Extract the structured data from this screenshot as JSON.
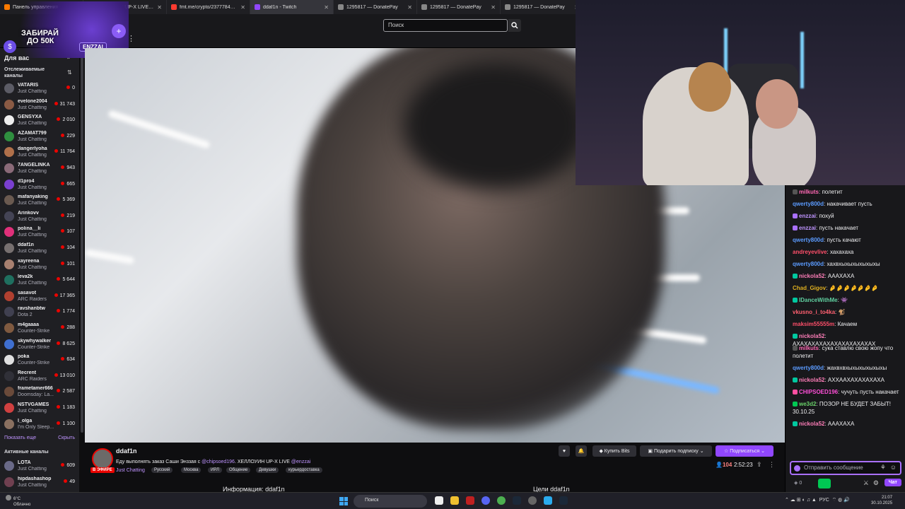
{
  "browser": {
    "tabs": [
      {
        "label": "Панель управления - Donatio",
        "color": "#ff7a00",
        "active": false
      },
      {
        "label": "ХЕЛЛОУИН UP-X LIVE - Twitch",
        "color": "#9147ff",
        "active": false
      },
      {
        "label": "fmt.me/crypto/237778422/cf39",
        "color": "#ff3b30",
        "active": false
      },
      {
        "label": "ddaf1n - Twitch",
        "color": "#9147ff",
        "active": true
      },
      {
        "label": "1295817 — DonatePay",
        "color": "#888888",
        "active": false
      },
      {
        "label": "1295817 — DonatePay",
        "color": "#888888",
        "active": false
      },
      {
        "label": "1295817 — DonatePay",
        "color": "#888888",
        "active": false
      }
    ]
  },
  "promo": {
    "line1": "ЗАБИРАЙ",
    "line2": "ДО 50К",
    "code_label": "ENZZAI",
    "coin": "$",
    "plus": "+"
  },
  "header": {
    "search_placeholder": "Поиск"
  },
  "sidebar": {
    "title": "Для вас",
    "followed_label": "Отслеживаемые каналы",
    "channels": [
      {
        "name": "VATARIS",
        "game": "Just Chatting",
        "viewers": "0",
        "color": "#5c5c66"
      },
      {
        "name": "evelone2004",
        "game": "Just Chatting",
        "viewers": "31 743",
        "color": "#8a5a44"
      },
      {
        "name": "GENSYXA",
        "game": "Just Chatting",
        "viewers": "2 010",
        "color": "#eeeeee"
      },
      {
        "name": "AZAMAT799",
        "game": "Just Chatting",
        "viewers": "229",
        "color": "#2f8f3f"
      },
      {
        "name": "dangerlyoha",
        "game": "Just Chatting",
        "viewers": "11 764",
        "color": "#b0704a"
      },
      {
        "name": "7ANGELINKA",
        "game": "Just Chatting",
        "viewers": "943",
        "color": "#8a6a78"
      },
      {
        "name": "d1pro4",
        "game": "Just Chatting",
        "viewers": "665",
        "color": "#7a3fd0"
      },
      {
        "name": "mafanyaking",
        "game": "Just Chatting",
        "viewers": "5 369",
        "color": "#6a5a50"
      },
      {
        "name": "Arinkovv",
        "game": "Just Chatting",
        "viewers": "219",
        "color": "#444455"
      },
      {
        "name": "polina__li",
        "game": "Just Chatting",
        "viewers": "107",
        "color": "#e0307a"
      },
      {
        "name": "ddaf1n",
        "game": "Just Chatting",
        "viewers": "104",
        "color": "#777070"
      },
      {
        "name": "xayreena",
        "game": "Just Chatting",
        "viewers": "101",
        "color": "#a88070"
      },
      {
        "name": "leva2k",
        "game": "Just Chatting",
        "viewers": "5 644",
        "color": "#1f6f5f"
      },
      {
        "name": "sasavot",
        "game": "ARC Raiders",
        "viewers": "17 365",
        "color": "#b04030"
      },
      {
        "name": "ravshanbtw",
        "game": "Dota 2",
        "viewers": "1 774",
        "color": "#404050"
      },
      {
        "name": "m4gaaaa",
        "game": "Counter-Strike",
        "viewers": "288",
        "color": "#805a40"
      },
      {
        "name": "skywhywalker",
        "game": "Counter-Strike",
        "viewers": "8 625",
        "color": "#3f6fd0"
      },
      {
        "name": "poka",
        "game": "Counter-Strike",
        "viewers": "634",
        "color": "#e0e0e0"
      },
      {
        "name": "Recrent",
        "game": "ARC Raiders",
        "viewers": "13 010",
        "color": "#303038"
      },
      {
        "name": "frametamer666",
        "game": "Doomsday: La...",
        "viewers": "2 587",
        "color": "#6a4a3a"
      },
      {
        "name": "NSTVGAMES",
        "game": "Just Chatting",
        "viewers": "1 183",
        "color": "#d04040"
      },
      {
        "name": "l_olga",
        "game": "I'm Only Sleep...",
        "viewers": "1 100",
        "color": "#8a7060"
      }
    ],
    "show_more": "Показать еще",
    "hide": "Скрыть",
    "active_label": "Активные каналы",
    "active_channels": [
      {
        "name": "LOTA",
        "game": "Just Chatting",
        "viewers": "609",
        "color": "#6a6a88"
      },
      {
        "name": "hipdashashop",
        "game": "Just Chatting",
        "viewers": "49",
        "color": "#704050"
      }
    ]
  },
  "stream": {
    "streamer": "ddaf1n",
    "live_badge": "В ЭФИРЕ",
    "title": "Еду выполнять заказ Саши Энззая с ",
    "mention1": "@chipsoed196",
    "title2": ". ХЕЛЛОУИН UP-X LIVE ",
    "mention2": "@enzzai",
    "category": "Just Chatting",
    "tags": [
      "Русский",
      "Москва",
      "ИРЛ",
      "Общение",
      "Девушки",
      "курьердоставка"
    ],
    "buy_bits": "Купить Bits",
    "gift_sub": "Подарить подписку",
    "subscribe": "Подписаться",
    "viewers": "104",
    "uptime": "2:52:23",
    "about": "Информация: ddaf1n",
    "goals": "Цели ddaf1n"
  },
  "chat": {
    "messages": [
      {
        "user": "milkuts",
        "color": "#ff69b4",
        "text": "полетит",
        "badge": "#555555"
      },
      {
        "user": "qwerty800d",
        "color": "#5b9bff",
        "text": "накачивает пусть",
        "badge": ""
      },
      {
        "user": "enzzai",
        "color": "#bf94ff",
        "text": "похуй",
        "badge": "#a970ff"
      },
      {
        "user": "enzzai",
        "color": "#bf94ff",
        "text": "пусть накачает",
        "badge": "#a970ff"
      },
      {
        "user": "qwerty800d",
        "color": "#5b9bff",
        "text": "пусть качают",
        "badge": ""
      },
      {
        "user": "andreyevlive",
        "color": "#ff4f6a",
        "text": "хахахаха",
        "badge": ""
      },
      {
        "user": "qwerty800d",
        "color": "#5b9bff",
        "text": "хахвхыхыхыхыхыхы",
        "badge": ""
      },
      {
        "user": "nickola52",
        "color": "#ff7eb9",
        "text": "АААХАХА",
        "badge": "#00c8a0"
      },
      {
        "user": "Chad_Gigov",
        "color": "#e0b020",
        "text": "🤌🤌🤌🤌🤌🤌🤌",
        "badge": ""
      },
      {
        "user": "IDanceWithMe",
        "color": "#60d0a0",
        "text": "👾",
        "badge": "#00c8a0"
      },
      {
        "user": "vkusno_i_to4ka",
        "color": "#ff6070",
        "text": "🐒",
        "badge": ""
      },
      {
        "user": "maksim55555m",
        "color": "#ff4f6a",
        "text": "Качаем",
        "badge": ""
      },
      {
        "user": "nickola52",
        "color": "#ff7eb9",
        "text": "АХАХАХАХАХАХАХАХАХАХАХ",
        "badge": "#00c8a0"
      },
      {
        "user": "milkuts",
        "color": "#ff69b4",
        "text": "сука ставлю свою жопу что полетит",
        "badge": "#555555"
      },
      {
        "user": "qwerty800d",
        "color": "#5b9bff",
        "text": "жахвхвхыхыхыхыхыхы",
        "badge": ""
      },
      {
        "user": "nickola52",
        "color": "#ff7eb9",
        "text": "АХХААХАХАХАХАХА",
        "badge": "#00c8a0"
      },
      {
        "user": "CHIPSOED196",
        "color": "#ff4fd8",
        "text": "чучуть пусть накачает",
        "badge": "#ff4fa0"
      },
      {
        "user": "we3d2",
        "color": "#6ad16a",
        "text": "ПОЗОР НЕ БУДЕТ ЗАБЫТ! 30.10.25",
        "badge": "#00c853"
      },
      {
        "user": "nickola52",
        "color": "#ff7eb9",
        "text": "АААХАХА",
        "badge": "#00c8a0"
      }
    ],
    "input_placeholder": "Отправить сообщение",
    "points": "0",
    "chat_button": "Чат"
  },
  "taskbar": {
    "temp": "6°C",
    "weather": "Облачно",
    "search": "Поиск",
    "lang": "РУС",
    "time": "21:07",
    "date": "30.10.2025"
  }
}
